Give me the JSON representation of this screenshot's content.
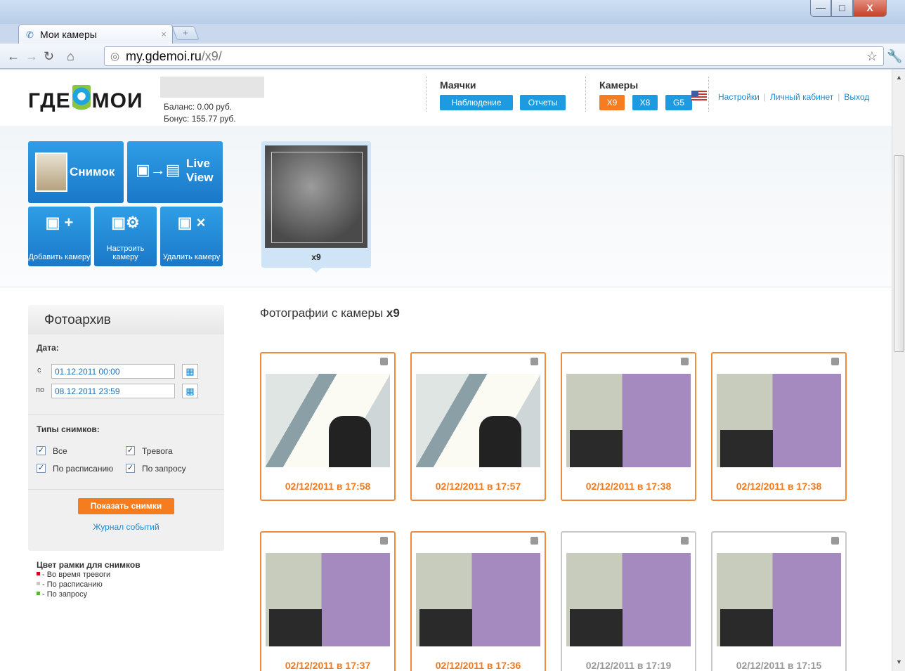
{
  "browser": {
    "tab_title": "Мои камеры",
    "tab_close": "×",
    "new_tab": "+",
    "url_host": "my.gdemoi.ru",
    "url_path": "/x9/",
    "win_min": "—",
    "win_max": "□",
    "win_close": "X"
  },
  "header": {
    "logo_left": "ГДЕ",
    "logo_right": "МОИ",
    "balance": "Баланс: 0.00 руб.",
    "bonus": "Бонус: 155.77 руб.",
    "beacons_title": "Маячки",
    "beacons_buttons": [
      "Наблюдение",
      "Отчеты"
    ],
    "cameras_title": "Камеры",
    "camera_buttons": [
      "X9",
      "X8",
      "G5"
    ],
    "links": [
      "Настройки",
      "Личный кабинет",
      "Выход"
    ]
  },
  "tiles": {
    "snapshot": "Снимок",
    "live_view": "Live View",
    "add_camera": "Добавить камеру",
    "setup_camera": "Настроить камеру",
    "delete_camera": "Удалить камеру"
  },
  "camera_card": {
    "label": "x9"
  },
  "sidebar": {
    "title": "Фотоархив",
    "date_label": "Дата:",
    "from_label": "с",
    "to_label": "по",
    "from_value": "01.12.2011 00:00",
    "to_value": "08.12.2011 23:59",
    "types_label": "Типы снимков:",
    "checkboxes": [
      {
        "label": "Все",
        "checked": true
      },
      {
        "label": "Тревога",
        "checked": true
      },
      {
        "label": "По расписанию",
        "checked": true
      },
      {
        "label": "По запросу",
        "checked": true
      }
    ],
    "show_button": "Показать снимки",
    "journal_link": "Журнал событий"
  },
  "legend": {
    "title": "Цвет рамки для снимков",
    "items": [
      {
        "label": "- Во время тревоги",
        "color": "#d7001a"
      },
      {
        "label": "- По расписанию",
        "color": "#c9c9c9"
      },
      {
        "label": "- По запросу",
        "color": "#5bb43a"
      }
    ]
  },
  "photos": {
    "title_prefix": "Фотографии с камеры",
    "camera_name": "x9",
    "items": [
      {
        "datetime": "02/12/2011 в 17:58",
        "type": "office",
        "frame": "orange"
      },
      {
        "datetime": "02/12/2011 в 17:57",
        "type": "office",
        "frame": "orange"
      },
      {
        "datetime": "02/12/2011 в 17:38",
        "type": "purple",
        "frame": "orange"
      },
      {
        "datetime": "02/12/2011 в 17:38",
        "type": "purple",
        "frame": "orange"
      },
      {
        "datetime": "02/12/2011 в 17:37",
        "type": "purple",
        "frame": "orange"
      },
      {
        "datetime": "02/12/2011 в 17:36",
        "type": "purple",
        "frame": "orange"
      },
      {
        "datetime": "02/12/2011 в 17:19",
        "type": "purple",
        "frame": "gray"
      },
      {
        "datetime": "02/12/2011 в 17:15",
        "type": "purple",
        "frame": "gray"
      }
    ]
  },
  "colors": {
    "accent_blue": "#1e9ae0",
    "accent_orange": "#f57c1f"
  }
}
